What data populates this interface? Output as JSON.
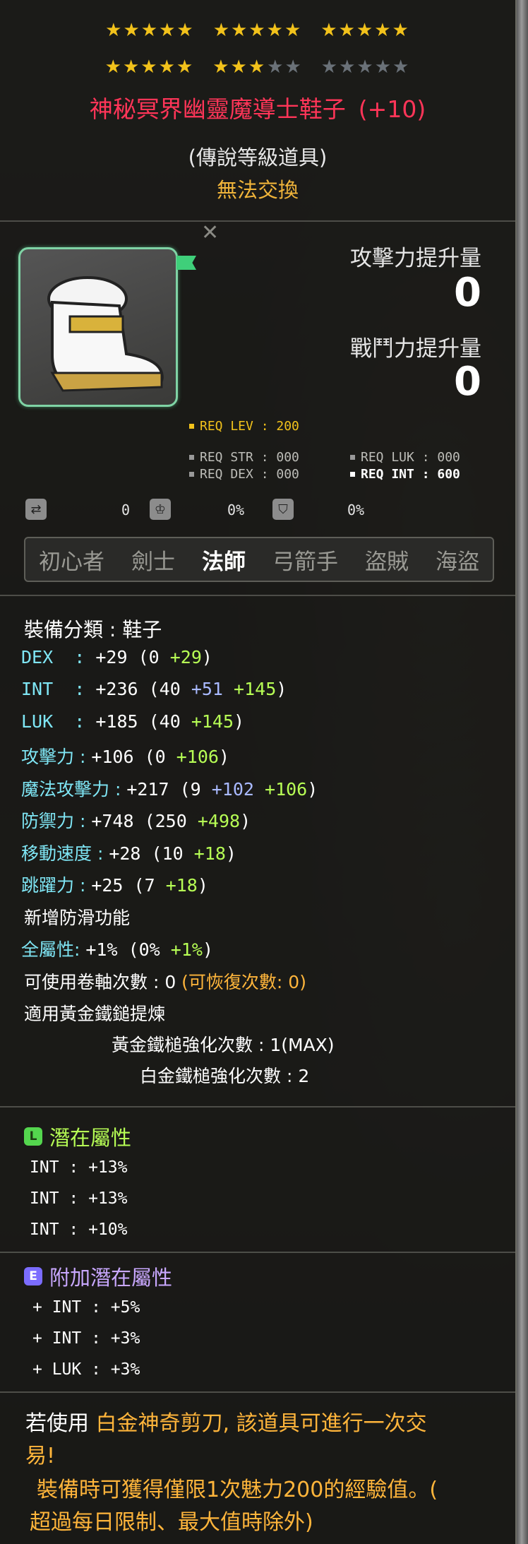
{
  "stars": {
    "row1": {
      "on": 15,
      "off": 0
    },
    "row2": {
      "on": 8,
      "off": 7
    }
  },
  "item": {
    "name": "神秘冥界幽靈魔導士鞋子",
    "enhance_level": "(+10)",
    "rarity": "(傳說等級道具)",
    "trade": "無法交換"
  },
  "gain": {
    "attack_label": "攻擊力提升量",
    "attack_value": "0",
    "combat_label": "戰鬥力提升量",
    "combat_value": "0"
  },
  "requirements": {
    "lev": "REQ LEV : 200",
    "str": "REQ STR : 000",
    "luk": "REQ LUK : 000",
    "dex": "REQ DEX : 000",
    "int": "REQ INT : 600"
  },
  "mini_stats": {
    "v1": "0",
    "v2": "0%",
    "v3": "0%"
  },
  "jobs": [
    "初心者",
    "劍士",
    "法師",
    "弓箭手",
    "盜賊",
    "海盜"
  ],
  "active_job": "法師",
  "stats": {
    "category": "裝備分類 : 鞋子",
    "dex_label": "DEX  : ",
    "dex_val": "+29 (0 ",
    "dex_bonus": "+29",
    "dex_end": ")",
    "int_label": "INT  : ",
    "int_val": "+236 (40 ",
    "int_a": "+51",
    "int_b": " +145",
    "int_end": ")",
    "luk_label": "LUK  : ",
    "luk_val": "+185 (40 ",
    "luk_b": "+145",
    "luk_end": ")",
    "atk_label": "攻擊力 : ",
    "atk_val": "+106 (0 ",
    "atk_b": "+106",
    "atk_end": ")",
    "matk_label": "魔法攻擊力 : ",
    "matk_val": "+217 (9 ",
    "matk_a": "+102",
    "matk_b": " +106",
    "matk_end": ")",
    "def_label": "防禦力 : ",
    "def_val": "+748 (250 ",
    "def_b": "+498",
    "def_end": ")",
    "spd_label": "移動速度 : ",
    "spd_val": "+28 (10 ",
    "spd_b": "+18",
    "spd_end": ")",
    "jump_label": "跳躍力 : ",
    "jump_val": "+25 (7 ",
    "jump_b": "+18",
    "jump_end": ")",
    "antislip": "新增防滑功能",
    "allstat_label": "全屬性: ",
    "allstat_val": "+1% (0% ",
    "allstat_b": "+1%",
    "allstat_end": ")",
    "scroll": "可使用卷軸次數 : 0 ",
    "scroll_recover": "(可恢復次數: 0)",
    "golden_apply": "適用黃金鐵鎚提煉",
    "golden_count": "黃金鐵槌強化次數 : 1(MAX)",
    "platinum_count": "白金鐵槌強化次數 : 2"
  },
  "potential": {
    "title": "潛在屬性",
    "lines": [
      "INT : +13%",
      "INT : +13%",
      "INT : +10%"
    ]
  },
  "bonus_potential": {
    "title": "附加潛在屬性",
    "lines": [
      "+ INT : +5%",
      "+ INT : +3%",
      "+ LUK : +3%"
    ]
  },
  "footer": {
    "line1_a": "若使用 ",
    "line1_b": "白金神奇剪刀, 該道具可進行一次交",
    "line2": "易!",
    "line3": "裝備時可獲得僅限1次魅力200的經驗值。(",
    "line4": "超過每日限制、最大值時除外)"
  },
  "colors": {
    "title": "#ff3558",
    "trade": "#f0b43a",
    "green": "#b7ff55",
    "cyan": "#7fe6f5",
    "blue": "#a9b9ff",
    "orange": "#ffb53b"
  }
}
